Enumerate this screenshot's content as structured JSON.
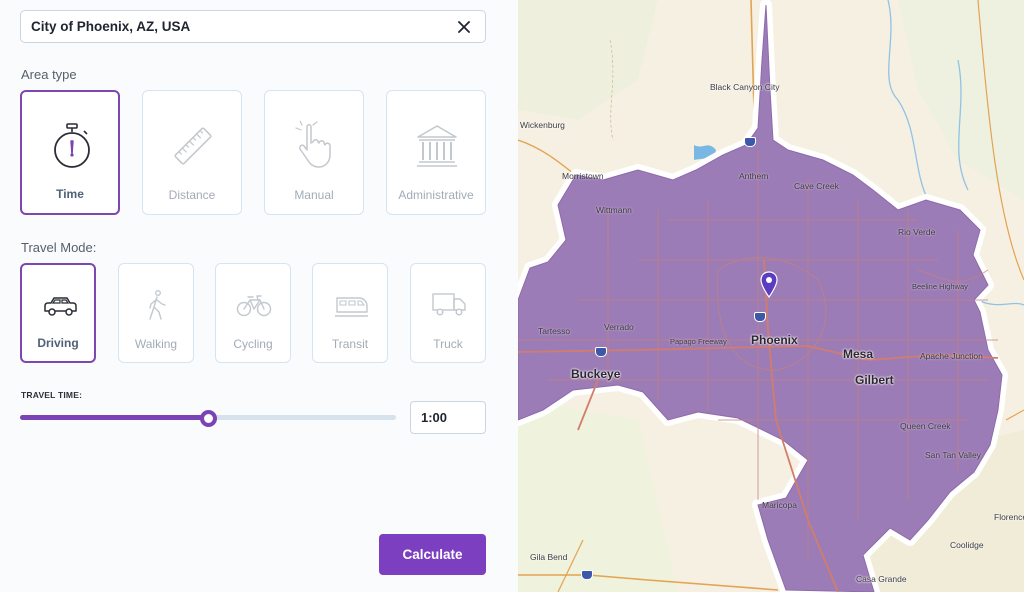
{
  "search": {
    "value": "City of Phoenix, AZ, USA"
  },
  "area_type": {
    "label": "Area type",
    "options": [
      {
        "label": "Time",
        "icon": "stopwatch-icon",
        "selected": true
      },
      {
        "label": "Distance",
        "icon": "ruler-icon",
        "selected": false
      },
      {
        "label": "Manual",
        "icon": "hand-pointer-icon",
        "selected": false
      },
      {
        "label": "Administrative",
        "icon": "government-building-icon",
        "selected": false
      }
    ]
  },
  "travel_mode": {
    "label": "Travel Mode:",
    "options": [
      {
        "label": "Driving",
        "icon": "car-icon",
        "selected": true
      },
      {
        "label": "Walking",
        "icon": "walking-person-icon",
        "selected": false
      },
      {
        "label": "Cycling",
        "icon": "bicycle-icon",
        "selected": false
      },
      {
        "label": "Transit",
        "icon": "train-icon",
        "selected": false
      },
      {
        "label": "Truck",
        "icon": "truck-icon",
        "selected": false
      }
    ]
  },
  "travel_time": {
    "label": "TRAVEL TIME:",
    "value": "1:00",
    "slider_fraction": 0.5
  },
  "calculate": {
    "label": "Calculate"
  },
  "colors": {
    "accent": "#7b43b4",
    "isochrone_fill": "#9c7cb6",
    "card_border": "#d3e5f3"
  },
  "map": {
    "places": {
      "black_canyon_city": "Black Canyon City",
      "wickenburg": "Wickenburg",
      "morristown": "Morristown",
      "anthem": "Anthem",
      "cave_creek": "Cave Creek",
      "wittmann": "Wittmann",
      "rio_verde": "Rio Verde",
      "beeline_highway": "Beeline Highway",
      "tartesso": "Tartesso",
      "verrado": "Verrado",
      "papago_freeway": "Papago Freeway",
      "phoenix": "Phoenix",
      "mesa": "Mesa",
      "apache_junction": "Apache Junction",
      "buckeye": "Buckeye",
      "gilbert": "Gilbert",
      "queen_creek": "Queen Creek",
      "san_tan_valley": "San Tan Valley",
      "maricopa": "Maricopa",
      "florence": "Florence",
      "coolidge": "Coolidge",
      "gila_bend": "Gila Bend",
      "casa_grande": "Casa Grande"
    }
  }
}
